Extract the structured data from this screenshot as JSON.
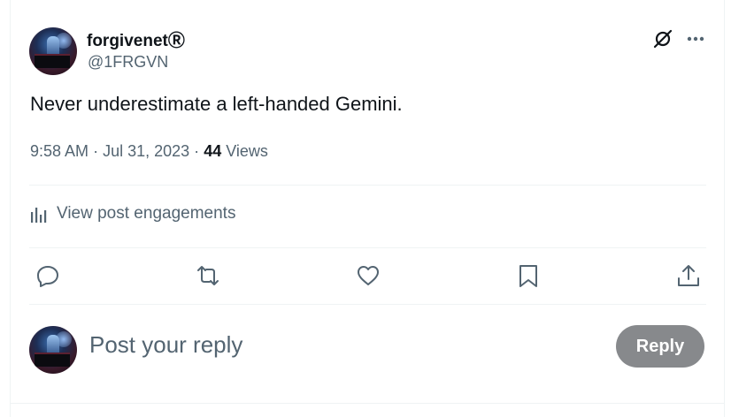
{
  "author": {
    "display_name": "forgivenetⓇ",
    "handle": "@1FRGVN"
  },
  "post": {
    "text": "Never underestimate a left-handed Gemini.",
    "time": "9:58 AM",
    "separator": "·",
    "date": "Jul 31, 2023",
    "views_count": "44",
    "views_label": "Views"
  },
  "engagements": {
    "label": "View post engagements",
    "icon": "bar-chart-icon"
  },
  "actions": {
    "icons": [
      "reply-icon",
      "repost-icon",
      "like-icon",
      "bookmark-icon",
      "share-icon"
    ]
  },
  "reply": {
    "placeholder": "Post your reply",
    "button_label": "Reply"
  },
  "colors": {
    "text_primary": "#0f1419",
    "text_secondary": "#536471",
    "divider": "#eff3f4",
    "reply_button_disabled": "#87898c"
  }
}
